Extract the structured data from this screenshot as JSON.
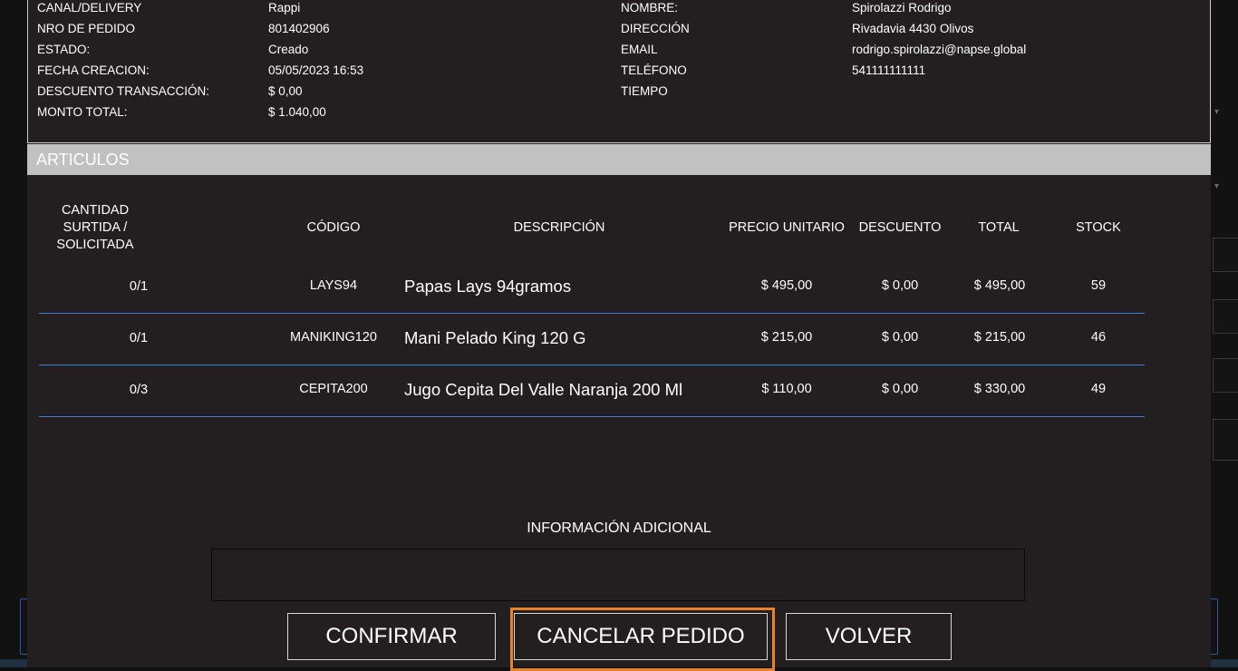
{
  "order": {
    "left": [
      {
        "label": "CANAL/DELIVERY",
        "value": "Rappi"
      },
      {
        "label": "NRO DE PEDIDO",
        "value": "801402906"
      },
      {
        "label": "ESTADO:",
        "value": "Creado"
      },
      {
        "label": "FECHA CREACION:",
        "value": "05/05/2023 16:53"
      },
      {
        "label": "DESCUENTO TRANSACCIÓN:",
        "value": "$ 0,00"
      },
      {
        "label": "MONTO TOTAL:",
        "value": "$ 1.040,00"
      }
    ],
    "right": [
      {
        "label": "NOMBRE:",
        "value": "Spirolazzi Rodrigo"
      },
      {
        "label": "DIRECCIÓN",
        "value": "Rivadavia 4430 Olivos"
      },
      {
        "label": "EMAIL",
        "value": "rodrigo.spirolazzi@napse.global"
      },
      {
        "label": "TELÉFONO",
        "value": "541111111111"
      },
      {
        "label": "TIEMPO",
        "value": ""
      }
    ]
  },
  "articles": {
    "section_title": "ARTICULOS",
    "headers": {
      "quantity": [
        "CANTIDAD",
        "SURTIDA /",
        "SOLICITADA"
      ],
      "code": "CÓDIGO",
      "description": "DESCRIPCIÓN",
      "unit_price": "PRECIO UNITARIO",
      "discount": "DESCUENTO",
      "total": "TOTAL",
      "stock": "STOCK"
    },
    "rows": [
      {
        "quantity": "0/1",
        "code": "LAYS94",
        "description": "Papas Lays 94gramos",
        "unit_price": "$ 495,00",
        "discount": "$ 0,00",
        "total": "$ 495,00",
        "stock": "59"
      },
      {
        "quantity": "0/1",
        "code": "MANIKING120",
        "description": "Mani Pelado King 120 G",
        "unit_price": "$ 215,00",
        "discount": "$ 0,00",
        "total": "$ 215,00",
        "stock": "46"
      },
      {
        "quantity": "0/3",
        "code": "CEPITA200",
        "description": "Jugo Cepita Del Valle Naranja 200 Ml",
        "unit_price": "$ 110,00",
        "discount": "$ 0,00",
        "total": "$ 330,00",
        "stock": "49"
      }
    ]
  },
  "additional_info": {
    "label": "INFORMACIÓN ADICIONAL",
    "value": ""
  },
  "buttons": {
    "confirm": "CONFIRMAR",
    "cancel_order": "CANCELAR PEDIDO",
    "back": "VOLVER"
  },
  "colors": {
    "dialog_bg": "#231f20",
    "section_bar": "#c1c1c1",
    "row_divider": "#3a7bd5",
    "focus_ring": "#e8822a"
  }
}
